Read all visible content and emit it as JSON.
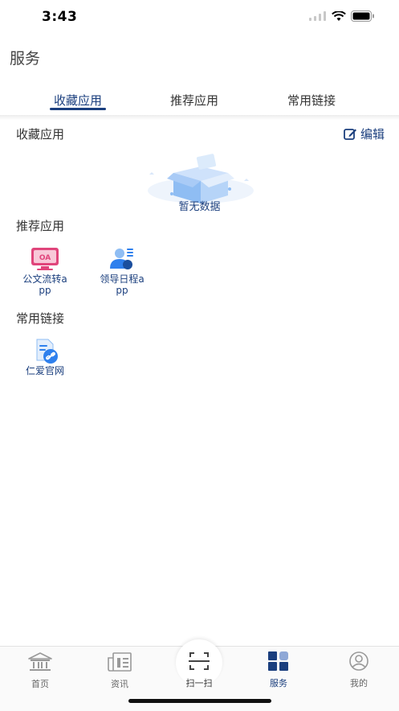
{
  "status_bar": {
    "time": "3:43"
  },
  "header": {
    "title": "服务"
  },
  "tabs": [
    {
      "label": "收藏应用",
      "active": true
    },
    {
      "label": "推荐应用",
      "active": false
    },
    {
      "label": "常用链接",
      "active": false
    }
  ],
  "favorites": {
    "title": "收藏应用",
    "edit_label": "编辑",
    "empty_text": "暂无数据"
  },
  "recommended": {
    "title": "推荐应用",
    "apps": [
      {
        "label": "公文流转app",
        "icon": "oa-document-icon",
        "icon_text": "OA"
      },
      {
        "label": "领导日程app",
        "icon": "leader-schedule-icon"
      }
    ]
  },
  "links": {
    "title": "常用链接",
    "items": [
      {
        "label": "仁爱官网",
        "icon": "website-link-icon"
      }
    ]
  },
  "tabbar": {
    "items": [
      {
        "label": "首页",
        "icon": "home-building-icon",
        "active": false
      },
      {
        "label": "资讯",
        "icon": "news-icon",
        "active": false
      },
      {
        "label": "扫一扫",
        "icon": "scan-icon",
        "active": false
      },
      {
        "label": "服务",
        "icon": "services-grid-icon",
        "active": true
      },
      {
        "label": "我的",
        "icon": "profile-icon",
        "active": false
      }
    ]
  },
  "colors": {
    "accent": "#1b3f7e",
    "oa_pink": "#e0457b",
    "icon_blue": "#2f80ed"
  }
}
